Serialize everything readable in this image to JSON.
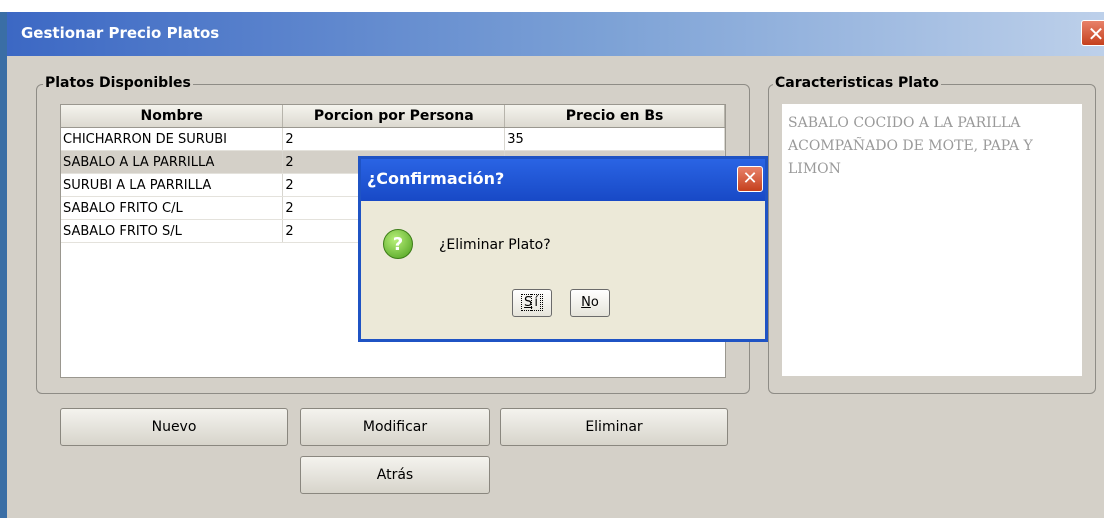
{
  "window": {
    "title": "Gestionar Precio Platos",
    "close_glyph": "✕"
  },
  "platos": {
    "legend": "Platos Disponibles",
    "columns": [
      "Nombre",
      "Porcion por Persona",
      "Precio en Bs"
    ],
    "rows": [
      [
        "CHICHARRON DE SURUBI",
        "2",
        "35"
      ],
      [
        "SABALO A LA PARRILLA",
        "2",
        ""
      ],
      [
        "SURUBI A LA PARRILLA",
        "2",
        ""
      ],
      [
        "SABALO FRITO C/L",
        "2",
        ""
      ],
      [
        "SABALO FRITO S/L",
        "2",
        ""
      ]
    ]
  },
  "caracteristicas": {
    "legend": "Caracteristicas Plato",
    "text": "SABALO COCIDO A LA PARILLA ACOMPAÑADO DE MOTE, PAPA Y LIMON"
  },
  "buttons": {
    "nuevo": "Nuevo",
    "modificar": "Modificar",
    "eliminar": "Eliminar",
    "atras": "Atrás"
  },
  "dialog": {
    "title": "¿Confirmación?",
    "message": "¿Eliminar Plato?",
    "icon": "question-icon",
    "yes_mnemonic": "S",
    "yes_rest": "í",
    "no_mnemonic": "N",
    "no_rest": "o"
  },
  "colors": {
    "title_bar": "#3c68c4",
    "dialog_title": "#1f53c4",
    "window_bg": "#d4d0c8",
    "selected_row": "#d4d0c8"
  }
}
